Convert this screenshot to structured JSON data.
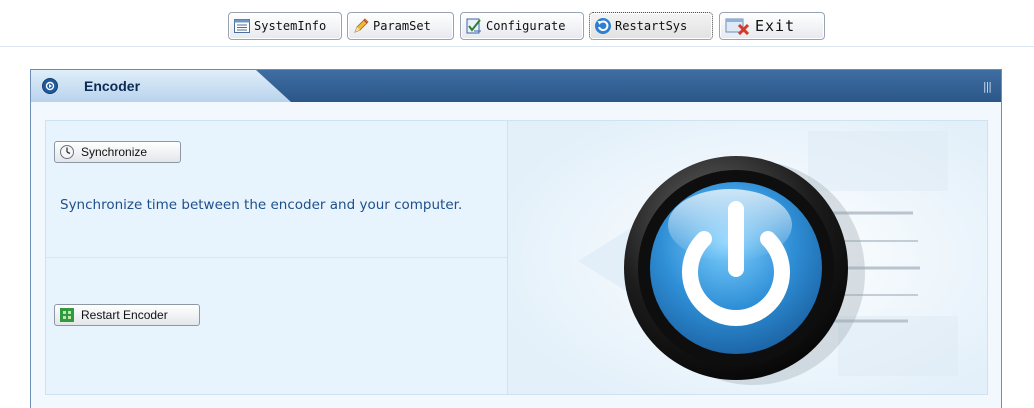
{
  "toolbar": {
    "system_info": "SystemInfo",
    "param_set": "ParamSet",
    "configurate": "Configurate",
    "restart_sys": "RestartSys",
    "exit": "Exit"
  },
  "panel": {
    "title": "Encoder",
    "header_grip": "|||"
  },
  "actions": {
    "synchronize_label": "Synchronize",
    "synchronize_desc": "Synchronize time between the encoder and your computer.",
    "restart_label": "Restart Encoder"
  },
  "icons": {
    "system_info": "list-icon",
    "param_set": "pencil-icon",
    "configurate": "checklist-icon",
    "restart_sys": "refresh-icon",
    "exit": "exit-icon",
    "panel": "circle-arrow-icon",
    "synchronize": "clock-icon",
    "restart_encoder": "restart-icon",
    "illustration": "power-button-icon"
  },
  "colors": {
    "panel_header": "#2b5688",
    "description_text": "#1f4f8a",
    "power_blue": "#2f8fd6"
  }
}
